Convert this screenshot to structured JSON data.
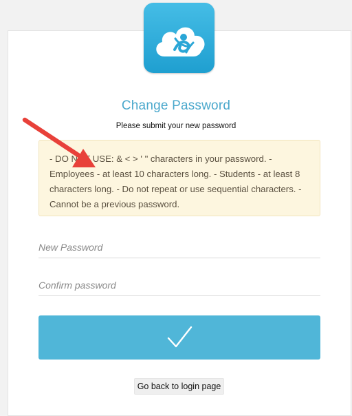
{
  "logo": {
    "icon": "cloud-logo-icon",
    "color": "#2fb0e0"
  },
  "form": {
    "title": "Change Password",
    "subtitle": "Please submit your new password",
    "requirements": "- DO NOT USE: & < > ' \" characters in your password. - Employees - at least 10 characters long. - Students - at least 8 characters long. - Do not repeat or use sequential characters. - Cannot be a previous password.",
    "new_password_placeholder": "New Password",
    "confirm_password_placeholder": "Confirm password",
    "submit_icon": "checkmark-icon",
    "back_label": "Go back to login page"
  },
  "annotation": {
    "icon": "red-arrow-icon",
    "color": "#e8413a"
  },
  "colors": {
    "accent": "#50b6d8",
    "title": "#4aa8cc",
    "notice_bg": "#fdf6df"
  }
}
